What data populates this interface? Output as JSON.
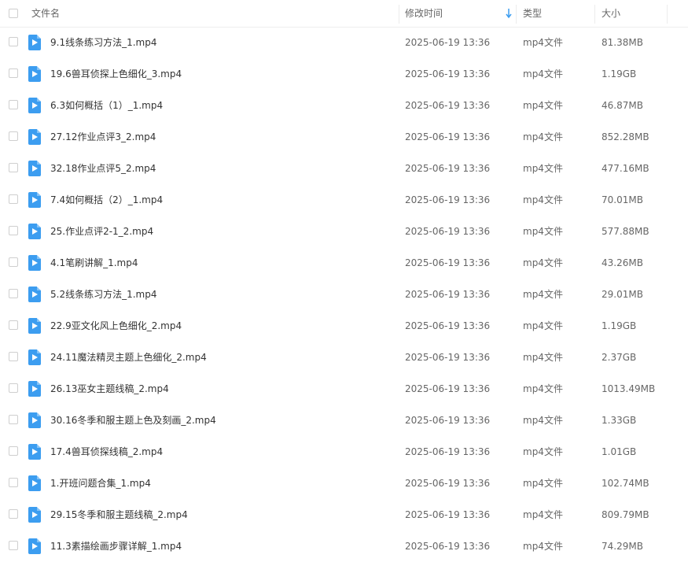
{
  "header": {
    "name_label": "文件名",
    "time_label": "修改时间",
    "type_label": "类型",
    "size_label": "大小",
    "sort_icon": "sort-down-arrow",
    "accent_color": "#3c9df0"
  },
  "files": [
    {
      "name": "9.1线条练习方法_1.mp4",
      "modified": "2025-06-19 13:36",
      "type": "mp4文件",
      "size": "81.38MB"
    },
    {
      "name": "19.6兽耳侦探上色细化_3.mp4",
      "modified": "2025-06-19 13:36",
      "type": "mp4文件",
      "size": "1.19GB"
    },
    {
      "name": "6.3如何概括（1）_1.mp4",
      "modified": "2025-06-19 13:36",
      "type": "mp4文件",
      "size": "46.87MB"
    },
    {
      "name": "27.12作业点评3_2.mp4",
      "modified": "2025-06-19 13:36",
      "type": "mp4文件",
      "size": "852.28MB"
    },
    {
      "name": "32.18作业点评5_2.mp4",
      "modified": "2025-06-19 13:36",
      "type": "mp4文件",
      "size": "477.16MB"
    },
    {
      "name": "7.4如何概括（2）_1.mp4",
      "modified": "2025-06-19 13:36",
      "type": "mp4文件",
      "size": "70.01MB"
    },
    {
      "name": "25.作业点评2-1_2.mp4",
      "modified": "2025-06-19 13:36",
      "type": "mp4文件",
      "size": "577.88MB"
    },
    {
      "name": "4.1笔刷讲解_1.mp4",
      "modified": "2025-06-19 13:36",
      "type": "mp4文件",
      "size": "43.26MB"
    },
    {
      "name": "5.2线条练习方法_1.mp4",
      "modified": "2025-06-19 13:36",
      "type": "mp4文件",
      "size": "29.01MB"
    },
    {
      "name": "22.9亚文化风上色细化_2.mp4",
      "modified": "2025-06-19 13:36",
      "type": "mp4文件",
      "size": "1.19GB"
    },
    {
      "name": "24.11魔法精灵主题上色细化_2.mp4",
      "modified": "2025-06-19 13:36",
      "type": "mp4文件",
      "size": "2.37GB"
    },
    {
      "name": "26.13巫女主题线稿_2.mp4",
      "modified": "2025-06-19 13:36",
      "type": "mp4文件",
      "size": "1013.49MB"
    },
    {
      "name": "30.16冬季和服主题上色及刻画_2.mp4",
      "modified": "2025-06-19 13:36",
      "type": "mp4文件",
      "size": "1.33GB"
    },
    {
      "name": "17.4兽耳侦探线稿_2.mp4",
      "modified": "2025-06-19 13:36",
      "type": "mp4文件",
      "size": "1.01GB"
    },
    {
      "name": "1.开班问题合集_1.mp4",
      "modified": "2025-06-19 13:36",
      "type": "mp4文件",
      "size": "102.74MB"
    },
    {
      "name": "29.15冬季和服主题线稿_2.mp4",
      "modified": "2025-06-19 13:36",
      "type": "mp4文件",
      "size": "809.79MB"
    },
    {
      "name": "11.3素描绘画步骤详解_1.mp4",
      "modified": "2025-06-19 13:36",
      "type": "mp4文件",
      "size": "74.29MB"
    }
  ]
}
